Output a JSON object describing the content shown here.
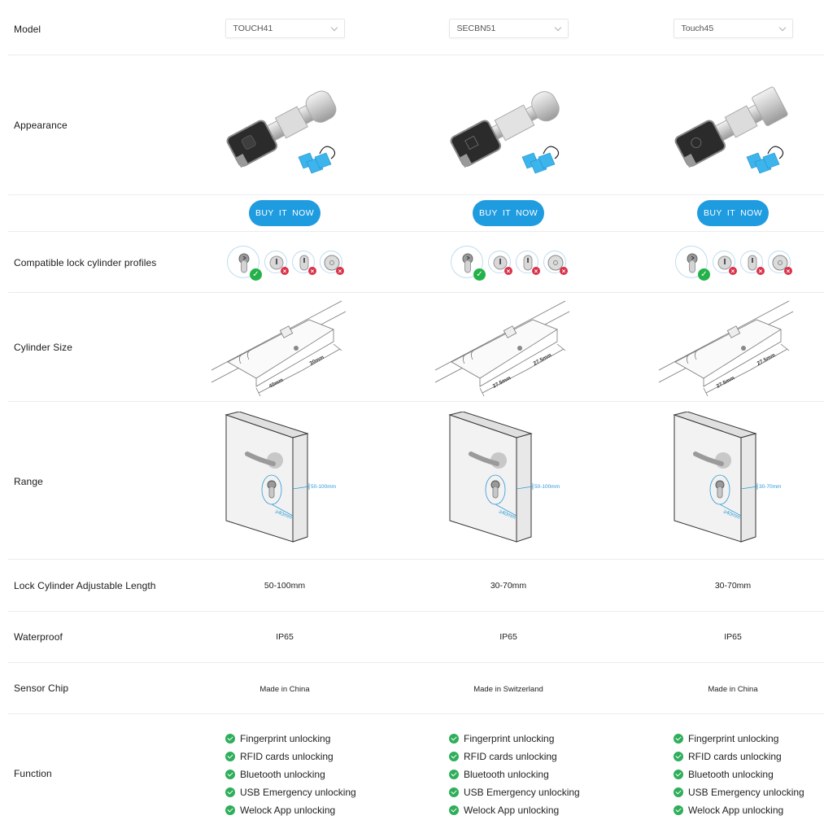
{
  "rows": {
    "model": {
      "label": "Model",
      "values": [
        "TOUCH41",
        "SECBN51",
        "Touch45"
      ]
    },
    "appearance": {
      "label": "Appearance",
      "image_desc": [
        "smart lock cylinder with fingerprint reader and blue RFID tags",
        "smart lock cylinder with fingerprint reader and blue RFID tags",
        "smart lock cylinder with fingerprint reader and blue RFID tags"
      ]
    },
    "buy": {
      "button_label": "BUY IT NOW"
    },
    "profiles": {
      "label": "Compatible lock cylinder profiles",
      "items": [
        {
          "type": "euro-profile",
          "compatible": true
        },
        {
          "type": "round-profile",
          "compatible": false
        },
        {
          "type": "oval-profile",
          "compatible": false
        },
        {
          "type": "round-disc-profile",
          "compatible": false
        }
      ]
    },
    "cylinder_size": {
      "label": "Cylinder Size",
      "values": [
        {
          "left": "40mm",
          "right": "30mm"
        },
        {
          "left": "27.5mm",
          "right": "27.5mm"
        },
        {
          "left": "27.5mm",
          "right": "27.5mm"
        }
      ]
    },
    "range": {
      "label": "Range",
      "values": [
        {
          "door": "50-100mm",
          "backset": "≥40mm"
        },
        {
          "door": "50-100mm",
          "backset": "≥40mm"
        },
        {
          "door": "30-70mm",
          "backset": "≥40mm"
        }
      ]
    },
    "adjustable_length": {
      "label": "Lock Cylinder Adjustable Length",
      "values": [
        "50-100mm",
        "30-70mm",
        "30-70mm"
      ]
    },
    "waterproof": {
      "label": "Waterproof",
      "values": [
        "IP65",
        "IP65",
        "IP65"
      ]
    },
    "sensor_chip": {
      "label": "Sensor Chip",
      "values": [
        "Made in China",
        "Made in Switzerland",
        "Made in China"
      ]
    },
    "function": {
      "label": "Function",
      "columns": [
        [
          "Fingerprint unlocking",
          "RFID cards unlocking",
          "Bluetooth unlocking",
          "USB Emergency unlocking",
          "Welock App unlocking"
        ],
        [
          "Fingerprint unlocking",
          "RFID cards unlocking",
          "Bluetooth unlocking",
          "USB Emergency unlocking",
          "Welock App unlocking"
        ],
        [
          "Fingerprint unlocking",
          "RFID cards unlocking",
          "Bluetooth unlocking",
          "USB Emergency unlocking",
          "Welock App unlocking"
        ]
      ]
    }
  },
  "colors": {
    "buy_button": "#1f9be0",
    "check_green": "#2eae5b",
    "cross_red": "#d9314a",
    "dimension_blue": "#2f9bd6"
  }
}
